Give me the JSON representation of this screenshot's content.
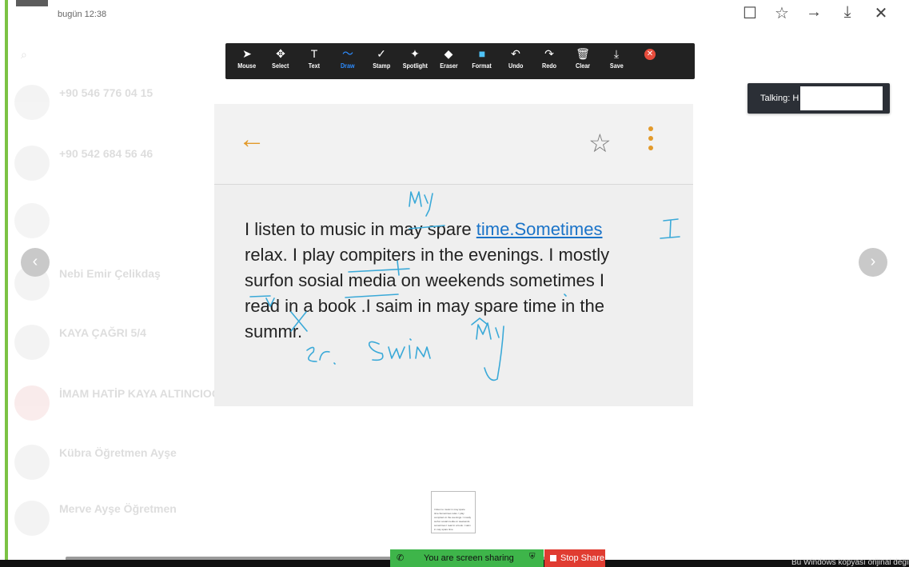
{
  "chat": {
    "time": "bugün 12:38",
    "contacts": [
      {
        "name": "+90 546 776 04 15",
        "sub": ""
      },
      {
        "name": "+90 542 684 56 46",
        "sub": ""
      },
      {
        "name": "",
        "sub": ""
      },
      {
        "name": "Nebi Emir Çelikdaş",
        "sub": ""
      },
      {
        "name": "KAYA ÇAĞRI 5/4",
        "sub": ""
      },
      {
        "name": "İMAM HATİP KAYA ALTINCIOĞLU",
        "sub": ""
      },
      {
        "name": "Kübra Öğretmen Ayşe",
        "sub": ""
      },
      {
        "name": "Merve Ayşe Öğretmen",
        "sub": ""
      }
    ]
  },
  "toolbar": {
    "tools": [
      {
        "label": "Mouse",
        "icon": "cursor-icon",
        "glyph": "➤"
      },
      {
        "label": "Select",
        "icon": "move-icon",
        "glyph": "✥"
      },
      {
        "label": "Text",
        "icon": "text-icon",
        "glyph": "T"
      },
      {
        "label": "Draw",
        "icon": "draw-icon",
        "glyph": "〜"
      },
      {
        "label": "Stamp",
        "icon": "checkmark-icon",
        "glyph": "✓"
      },
      {
        "label": "Spotlight",
        "icon": "spotlight-icon",
        "glyph": "✦"
      },
      {
        "label": "Eraser",
        "icon": "eraser-icon",
        "glyph": "◆"
      },
      {
        "label": "Format",
        "icon": "format-icon",
        "glyph": "■"
      },
      {
        "label": "Undo",
        "icon": "undo-icon",
        "glyph": "↶"
      },
      {
        "label": "Redo",
        "icon": "redo-icon",
        "glyph": "↷"
      },
      {
        "label": "Clear",
        "icon": "trash-icon",
        "glyph": "🗑"
      },
      {
        "label": "Save",
        "icon": "save-icon",
        "glyph": "⤓"
      }
    ],
    "active": "Draw",
    "active_color": "#2d8cff",
    "format_color": "#4fc3f7"
  },
  "talking": {
    "label": "Talking: H"
  },
  "document": {
    "line1_prefix": "I listen to music in may spare ",
    "line1_link": "time.Sometimes",
    "line2": "relax. I play compiters in the evenings. I mostly",
    "line3": "surfon sosial media on weekends sometimes I",
    "line4": "read in a book .I saim in may spare time in the",
    "line5": "summr."
  },
  "annotations": {
    "ink_color": "#3aa9d8",
    "notes": [
      "My",
      "I",
      "swim",
      "My",
      "er."
    ]
  },
  "sharing": {
    "status": "You are screen sharing",
    "stop_label": "Stop Share",
    "sharing_color": "#3eb54a",
    "stop_color": "#e03c31"
  },
  "windows_notice": "Bu Windows kopyası orijinal değil"
}
